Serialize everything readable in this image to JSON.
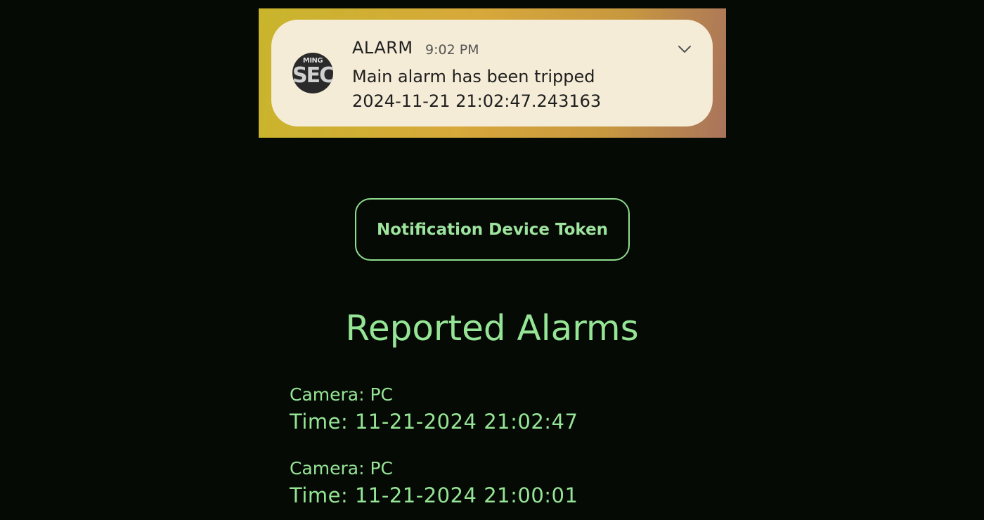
{
  "notification": {
    "app_icon_top": "MING",
    "app_icon_main": "SEC",
    "title": "ALARM",
    "time": "9:02 PM",
    "message": "Main alarm has been tripped",
    "timestamp": "2024-11-21 21:02:47.243163",
    "expand_icon": "chevron-down-icon"
  },
  "token_button": {
    "label": "Notification Device Token"
  },
  "alarms": {
    "heading": "Reported Alarms",
    "items": [
      {
        "camera": "Camera: PC",
        "time": "Time: 11-21-2024 21:02:47"
      },
      {
        "camera": "Camera: PC",
        "time": "Time: 11-21-2024 21:00:01"
      }
    ]
  },
  "colors": {
    "background": "#050a05",
    "accent_green": "#96e596",
    "card_background": "#f5ecd7"
  }
}
